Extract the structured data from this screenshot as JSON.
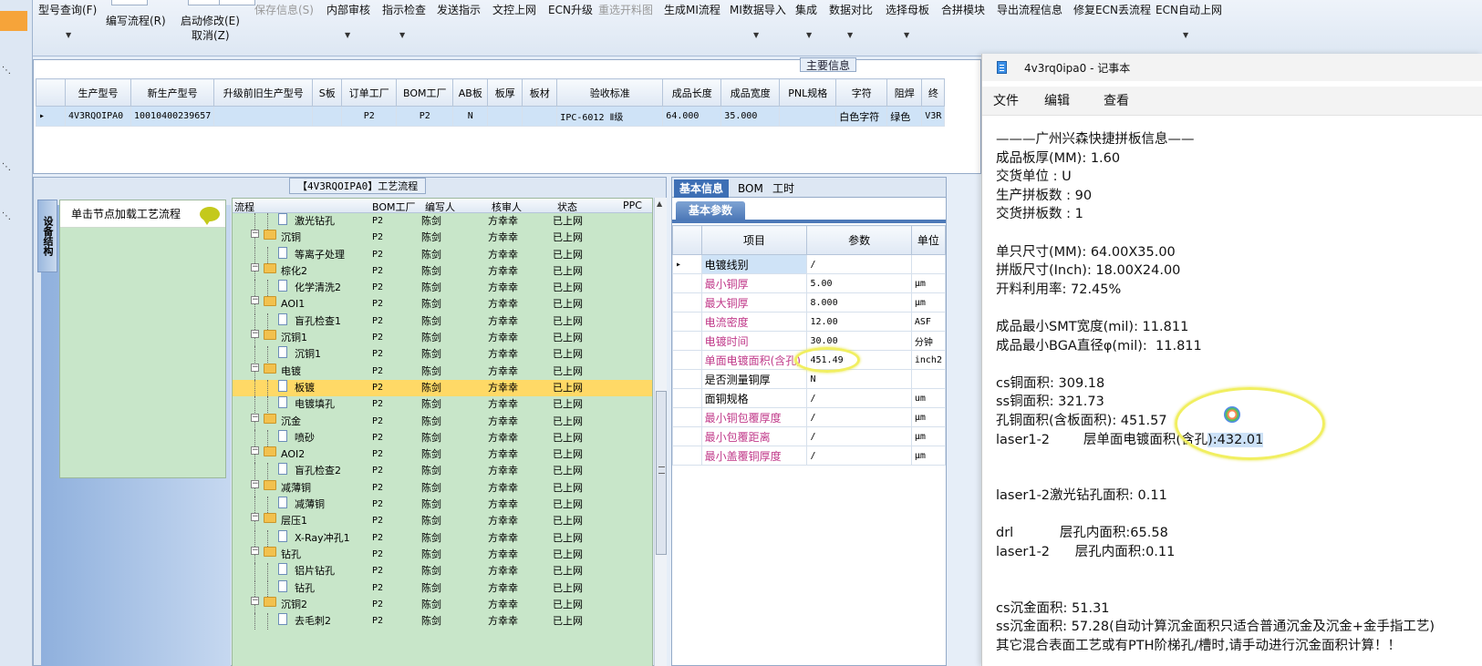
{
  "toolbar": {
    "items": [
      {
        "label": "型号查询(F)",
        "has_arrow": true,
        "disabled": false
      },
      {
        "label": "编写流程(R)",
        "has_arrow": false,
        "disabled": false
      },
      {
        "label": "启动修改(E)",
        "sub": "取消(Z)",
        "has_arrow": false,
        "disabled": false
      },
      {
        "label": "保存信息(S)",
        "has_arrow": false,
        "disabled": true
      },
      {
        "label": "内部审核",
        "has_arrow": true,
        "disabled": false
      },
      {
        "label": "指示检查",
        "has_arrow": true,
        "disabled": false
      },
      {
        "label": "发送指示",
        "has_arrow": false,
        "disabled": false
      },
      {
        "label": "文控上网",
        "has_arrow": false,
        "disabled": false
      },
      {
        "label": "ECN升级",
        "has_arrow": false,
        "disabled": false
      },
      {
        "label": "重选开料图",
        "has_arrow": false,
        "disabled": true
      },
      {
        "label": "生成MI流程",
        "has_arrow": false,
        "disabled": false
      },
      {
        "label": "MI数据导入",
        "has_arrow": true,
        "disabled": false
      },
      {
        "label": "集成",
        "has_arrow": true,
        "disabled": false
      },
      {
        "label": "数据对比",
        "has_arrow": true,
        "disabled": false
      },
      {
        "label": "选择母板",
        "has_arrow": true,
        "disabled": false
      },
      {
        "label": "合拼模块",
        "has_arrow": false,
        "disabled": false
      },
      {
        "label": "导出流程信息",
        "has_arrow": false,
        "disabled": false
      },
      {
        "label": "修复ECN丢流程",
        "has_arrow": false,
        "disabled": false
      },
      {
        "label": "ECN自动上网",
        "has_arrow": true,
        "disabled": false
      }
    ]
  },
  "main_info": {
    "caption": "主要信息",
    "columns": [
      "生产型号",
      "新生产型号",
      "升级前旧生产型号",
      "S板",
      "订单工厂",
      "BOM工厂",
      "AB板",
      "板厚",
      "板材",
      "验收标准",
      "成品长度",
      "成品宽度",
      "PNL规格",
      "字符",
      "阻焊",
      "终"
    ],
    "rows": [
      [
        "4V3RQOIPA0",
        "10010400239657",
        "",
        "",
        "P2",
        "P2",
        "N",
        "",
        "",
        "IPC-6012 Ⅱ级",
        "64.000",
        "35.000",
        "",
        "白色字符",
        "绿色",
        "V3R"
      ]
    ]
  },
  "flow": {
    "caption": "【4V3RQOIPA0】工艺流程",
    "side_tab": "设备结构",
    "node_hint": "单击节点加载工艺流程",
    "columns": [
      "流程",
      "BOM工厂",
      "编写人",
      "核审人",
      "状态",
      "PPC"
    ],
    "rows": [
      {
        "level": 2,
        "name": "激光钻孔",
        "bom": "P2",
        "writer": "陈剑",
        "reviewer": "方幸幸",
        "status": "已上网"
      },
      {
        "level": 1,
        "name": "沉铜",
        "bom": "P2",
        "writer": "陈剑",
        "reviewer": "方幸幸",
        "status": "已上网"
      },
      {
        "level": 2,
        "name": "等离子处理",
        "bom": "P2",
        "writer": "陈剑",
        "reviewer": "方幸幸",
        "status": "已上网"
      },
      {
        "level": 1,
        "name": "棕化2",
        "bom": "P2",
        "writer": "陈剑",
        "reviewer": "方幸幸",
        "status": "已上网"
      },
      {
        "level": 2,
        "name": "化学清洗2",
        "bom": "P2",
        "writer": "陈剑",
        "reviewer": "方幸幸",
        "status": "已上网"
      },
      {
        "level": 1,
        "name": "AOI1",
        "bom": "P2",
        "writer": "陈剑",
        "reviewer": "方幸幸",
        "status": "已上网"
      },
      {
        "level": 2,
        "name": "盲孔检查1",
        "bom": "P2",
        "writer": "陈剑",
        "reviewer": "方幸幸",
        "status": "已上网"
      },
      {
        "level": 1,
        "name": "沉铜1",
        "bom": "P2",
        "writer": "陈剑",
        "reviewer": "方幸幸",
        "status": "已上网"
      },
      {
        "level": 2,
        "name": "沉铜1",
        "bom": "P2",
        "writer": "陈剑",
        "reviewer": "方幸幸",
        "status": "已上网"
      },
      {
        "level": 1,
        "name": "电镀",
        "bom": "P2",
        "writer": "陈剑",
        "reviewer": "方幸幸",
        "status": "已上网"
      },
      {
        "level": 2,
        "name": "板镀",
        "bom": "P2",
        "writer": "陈剑",
        "reviewer": "方幸幸",
        "status": "已上网",
        "selected": true
      },
      {
        "level": 2,
        "name": "电镀填孔",
        "bom": "P2",
        "writer": "陈剑",
        "reviewer": "方幸幸",
        "status": "已上网"
      },
      {
        "level": 1,
        "name": "沉金",
        "bom": "P2",
        "writer": "陈剑",
        "reviewer": "方幸幸",
        "status": "已上网"
      },
      {
        "level": 2,
        "name": "喷砂",
        "bom": "P2",
        "writer": "陈剑",
        "reviewer": "方幸幸",
        "status": "已上网"
      },
      {
        "level": 1,
        "name": "AOI2",
        "bom": "P2",
        "writer": "陈剑",
        "reviewer": "方幸幸",
        "status": "已上网"
      },
      {
        "level": 2,
        "name": "盲孔检查2",
        "bom": "P2",
        "writer": "陈剑",
        "reviewer": "方幸幸",
        "status": "已上网"
      },
      {
        "level": 1,
        "name": "减薄铜",
        "bom": "P2",
        "writer": "陈剑",
        "reviewer": "方幸幸",
        "status": "已上网"
      },
      {
        "level": 2,
        "name": "减薄铜",
        "bom": "P2",
        "writer": "陈剑",
        "reviewer": "方幸幸",
        "status": "已上网"
      },
      {
        "level": 1,
        "name": "层压1",
        "bom": "P2",
        "writer": "陈剑",
        "reviewer": "方幸幸",
        "status": "已上网"
      },
      {
        "level": 2,
        "name": "X-Ray冲孔1",
        "bom": "P2",
        "writer": "陈剑",
        "reviewer": "方幸幸",
        "status": "已上网"
      },
      {
        "level": 1,
        "name": "钻孔",
        "bom": "P2",
        "writer": "陈剑",
        "reviewer": "方幸幸",
        "status": "已上网"
      },
      {
        "level": 2,
        "name": "铝片钻孔",
        "bom": "P2",
        "writer": "陈剑",
        "reviewer": "方幸幸",
        "status": "已上网"
      },
      {
        "level": 2,
        "name": "钻孔",
        "bom": "P2",
        "writer": "陈剑",
        "reviewer": "方幸幸",
        "status": "已上网"
      },
      {
        "level": 1,
        "name": "沉铜2",
        "bom": "P2",
        "writer": "陈剑",
        "reviewer": "方幸幸",
        "status": "已上网"
      },
      {
        "level": 2,
        "name": "去毛刺2",
        "bom": "P2",
        "writer": "陈剑",
        "reviewer": "方幸幸",
        "status": "已上网"
      }
    ]
  },
  "basic": {
    "tabs": [
      "基本信息",
      "BOM",
      "工时"
    ],
    "param_tab": "基本参数",
    "columns": [
      "项目",
      "参数",
      "单位"
    ],
    "rows": [
      {
        "item": "电镀线别",
        "value": "/",
        "unit": "",
        "pink": false
      },
      {
        "item": "最小铜厚",
        "value": "5.00",
        "unit": "μm",
        "pink": true
      },
      {
        "item": "最大铜厚",
        "value": "8.000",
        "unit": "μm",
        "pink": true
      },
      {
        "item": "电流密度",
        "value": "12.00",
        "unit": "ASF",
        "pink": true
      },
      {
        "item": "电镀时间",
        "value": "30.00",
        "unit": "分钟",
        "pink": true
      },
      {
        "item": "单面电镀面积(含孔)",
        "value": "451.49",
        "unit": "inch2",
        "pink": true
      },
      {
        "item": "是否测量铜厚",
        "value": "N",
        "unit": "",
        "pink": false
      },
      {
        "item": "面铜规格",
        "value": "/",
        "unit": "um",
        "pink": false
      },
      {
        "item": "最小铜包覆厚度",
        "value": "/",
        "unit": "μm",
        "pink": true
      },
      {
        "item": "最小包覆距离",
        "value": "/",
        "unit": "μm",
        "pink": true
      },
      {
        "item": "最小盖覆铜厚度",
        "value": "/",
        "unit": "μm",
        "pink": true
      }
    ]
  },
  "notepad": {
    "title": "4v3rq0ipa0 - 记事本",
    "menu": [
      "文件",
      "编辑",
      "查看"
    ],
    "lines": [
      "———广州兴森快捷拼板信息——",
      "成品板厚(MM): 1.60",
      "交货单位 : U",
      "生产拼板数 : 90",
      "交货拼板数 : 1",
      "",
      "单只尺寸(MM): 64.00X35.00",
      "拼版尺寸(Inch): 18.00X24.00",
      "开料利用率: 72.45%",
      "",
      "成品最小SMT宽度(mil): 11.811",
      "成品最小BGA直径φ(mil):  11.811",
      "",
      "cs铜面积: 309.18",
      "ss铜面积: 321.73",
      "孔铜面积(含板面积): 451.57",
      "laser1-2        层单面电镀面积(含孔):432.01",
      "",
      "",
      "laser1-2激光钻孔面积: 0.11",
      "",
      "drl           层孔内面积:65.58",
      "laser1-2      层孔内面积:0.11",
      "",
      "",
      "cs沉金面积: 51.31",
      "ss沉金面积: 57.28(自动计算沉金面积只适合普通沉金及沉金+金手指工艺)",
      "其它混合表面工艺或有PTH阶梯孔/槽时,请手动进行沉金面积计算！！"
    ]
  }
}
